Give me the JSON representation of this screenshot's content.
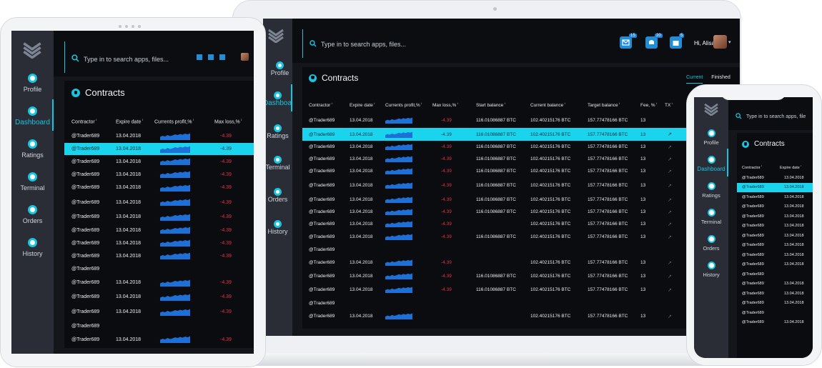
{
  "nav": [
    {
      "label": "Profile"
    },
    {
      "label": "Dashboard"
    },
    {
      "label": "Ratings"
    },
    {
      "label": "Terminal"
    },
    {
      "label": "Orders"
    },
    {
      "label": "History"
    }
  ],
  "search_placeholder": "Type in to search apps, files...",
  "phone_search_placeholder": "Type in to search apps, file",
  "page_title": "Contracts",
  "user": {
    "greeting": "Hi, Alisa",
    "caret": "▾"
  },
  "badges": {
    "messages": "15",
    "notifications": "20",
    "cart": "5"
  },
  "tabs": [
    "Current",
    "Finished"
  ],
  "columns": {
    "contractor": "Contractor",
    "expire": "Expire date",
    "profit": "Currents profit,%",
    "maxloss": "Max loss,%",
    "start": "Start balance",
    "current": "Current balance",
    "target": "Target balance",
    "fee": "Fee, %",
    "tx": "TX",
    "sort": "↕"
  },
  "laptop_rows": [
    {
      "contractor": "@Trader689",
      "expire": "13.04.2018",
      "chart": true,
      "maxloss": "-4.39",
      "start": "116.01086887 BTC",
      "current": "102.40215176 BTC",
      "target": "157.77478166 BTC",
      "fee": "13",
      "tx": false
    },
    {
      "contractor": "@Trader689",
      "expire": "13.04.2018",
      "chart": true,
      "maxloss": "-4.39",
      "start": "116.01086887 BTC",
      "current": "102.40215176 BTC",
      "target": "157.77478166 BTC",
      "fee": "13",
      "tx": true
    },
    {
      "contractor": "@Trader689",
      "expire": "13.04.2018",
      "chart": true,
      "maxloss": "-4.39",
      "start": "116.01086887 BTC",
      "current": "102.40215176 BTC",
      "target": "157.77478166 BTC",
      "fee": "13",
      "tx": true
    },
    {
      "contractor": "@Trader689",
      "expire": "13.04.2018",
      "chart": true,
      "maxloss": "-4.39",
      "start": "116.01086887 BTC",
      "current": "102.40215176 BTC",
      "target": "157.77478166 BTC",
      "fee": "13",
      "tx": true
    },
    {
      "contractor": "@Trader689",
      "expire": "13.04.2018",
      "chart": true,
      "maxloss": "-4.39",
      "start": "116.01086887 BTC",
      "current": "102.40215176 BTC",
      "target": "157.77478166 BTC",
      "fee": "13",
      "tx": true
    },
    {
      "contractor": "@Trader689",
      "expire": "13.04.2018",
      "chart": true,
      "maxloss": "-4.39",
      "start": "116.01086887 BTC",
      "current": "102.40215176 BTC",
      "target": "157.77478166 BTC",
      "fee": "13",
      "tx": true
    },
    {
      "contractor": "@Trader689",
      "expire": "13.04.2018",
      "chart": true,
      "maxloss": "-4.39",
      "start": "116.01086887 BTC",
      "current": "102.40215176 BTC",
      "target": "157.77478166 BTC",
      "fee": "13",
      "tx": true
    },
    {
      "contractor": "@Trader689",
      "expire": "13.04.2018",
      "chart": true,
      "maxloss": "-4.39",
      "start": "116.01086887 BTC",
      "current": "102.40215176 BTC",
      "target": "157.77478166 BTC",
      "fee": "13",
      "tx": true
    },
    {
      "contractor": "@Trader689",
      "expire": "13.04.2018",
      "chart": true,
      "maxloss": "-4.39",
      "start": "",
      "current": "102.40215176 BTC",
      "target": "157.77478166 BTC",
      "fee": "13",
      "tx": true
    },
    {
      "contractor": "@Trader689",
      "expire": "13.04.2018",
      "chart": true,
      "maxloss": "-4.39",
      "start": "116.01086887 BTC",
      "current": "102.40215176 BTC",
      "target": "157.77478166 BTC",
      "fee": "13",
      "tx": true
    },
    {
      "contractor": "@Trader689",
      "expire": "",
      "chart": false,
      "maxloss": "",
      "start": "",
      "current": "",
      "target": "",
      "fee": "",
      "tx": false
    },
    {
      "contractor": "@Trader689",
      "expire": "13.04.2018",
      "chart": true,
      "maxloss": "-4.39",
      "start": "",
      "current": "102.40215176 BTC",
      "target": "157.77478166 BTC",
      "fee": "13",
      "tx": true
    },
    {
      "contractor": "@Trader689",
      "expire": "13.04.2018",
      "chart": true,
      "maxloss": "-4.39",
      "start": "116.01086887 BTC",
      "current": "102.40215176 BTC",
      "target": "157.77478166 BTC",
      "fee": "13",
      "tx": true
    },
    {
      "contractor": "@Trader689",
      "expire": "13.04.2018",
      "chart": true,
      "maxloss": "-4.39",
      "start": "116.01086887 BTC",
      "current": "102.40215176 BTC",
      "target": "157.77478166 BTC",
      "fee": "13",
      "tx": true
    },
    {
      "contractor": "@Trader689",
      "expire": "",
      "chart": false,
      "maxloss": "",
      "start": "",
      "current": "",
      "target": "",
      "fee": "",
      "tx": false
    },
    {
      "contractor": "@Trader689",
      "expire": "13.04.2018",
      "chart": true,
      "maxloss": "",
      "start": "",
      "current": "102.40215176 BTC",
      "target": "157.77478166 BTC",
      "fee": "13",
      "tx": true
    }
  ],
  "tablet_rows": [
    {
      "contractor": "@Trader689",
      "expire": "13.04.2018",
      "chart": true,
      "maxloss": "-4.39"
    },
    {
      "contractor": "@Trader689",
      "expire": "13.04.2018",
      "chart": true,
      "maxloss": "-4.39"
    },
    {
      "contractor": "@Trader689",
      "expire": "13.04.2018",
      "chart": true,
      "maxloss": "-4.39"
    },
    {
      "contractor": "@Trader689",
      "expire": "13.04.2018",
      "chart": true,
      "maxloss": "-4.39"
    },
    {
      "contractor": "@Trader689",
      "expire": "13.04.2018",
      "chart": true,
      "maxloss": "-4.39"
    },
    {
      "contractor": "@Trader689",
      "expire": "13.04.2018",
      "chart": true,
      "maxloss": "-4.39"
    },
    {
      "contractor": "@Trader689",
      "expire": "13.04.2018",
      "chart": true,
      "maxloss": "-4.39"
    },
    {
      "contractor": "@Trader689",
      "expire": "13.04.2018",
      "chart": true,
      "maxloss": "-4.39"
    },
    {
      "contractor": "@Trader689",
      "expire": "13.04.2018",
      "chart": true,
      "maxloss": "-4.39"
    },
    {
      "contractor": "@Trader689",
      "expire": "13.04.2018",
      "chart": true,
      "maxloss": "-4.39"
    },
    {
      "contractor": "@Trader689",
      "expire": "",
      "chart": false,
      "maxloss": ""
    },
    {
      "contractor": "@Trader689",
      "expire": "13.04.2018",
      "chart": true,
      "maxloss": "-4.39"
    },
    {
      "contractor": "@Trader689",
      "expire": "13.04.2018",
      "chart": true,
      "maxloss": "-4.39"
    },
    {
      "contractor": "@Trader689",
      "expire": "13.04.2018",
      "chart": true,
      "maxloss": "-4.39"
    },
    {
      "contractor": "@Trader689",
      "expire": "",
      "chart": false,
      "maxloss": ""
    },
    {
      "contractor": "@Trader689",
      "expire": "13.04.2018",
      "chart": true,
      "maxloss": "-4.39"
    }
  ],
  "phone_rows": [
    {
      "contractor": "@Trader689",
      "expire": "13.04.2018"
    },
    {
      "contractor": "@Trader689",
      "expire": "13.04.2018"
    },
    {
      "contractor": "@Trader689",
      "expire": "13.04.2018"
    },
    {
      "contractor": "@Trader689",
      "expire": "13.04.2018"
    },
    {
      "contractor": "@Trader689",
      "expire": "13.04.2018"
    },
    {
      "contractor": "@Trader689",
      "expire": "13.04.2018"
    },
    {
      "contractor": "@Trader689",
      "expire": "13.04.2018"
    },
    {
      "contractor": "@Trader689",
      "expire": "13.04.2018"
    },
    {
      "contractor": "@Trader689",
      "expire": "13.04.2018"
    },
    {
      "contractor": "@Trader689",
      "expire": "13.04.2018"
    },
    {
      "contractor": "@Trader689",
      "expire": ""
    },
    {
      "contractor": "@Trader689",
      "expire": "13.04.2018"
    },
    {
      "contractor": "@Trader689",
      "expire": "13.04.2018"
    },
    {
      "contractor": "@Trader689",
      "expire": "13.04.2018"
    },
    {
      "contractor": "@Trader689",
      "expire": ""
    },
    {
      "contractor": "@Trader689",
      "expire": "13.04.2018"
    }
  ],
  "colors": {
    "accent": "#18c4e0",
    "negative": "#e23049",
    "sidebar": "#2a2d36",
    "chart": "#1e6fd6"
  }
}
